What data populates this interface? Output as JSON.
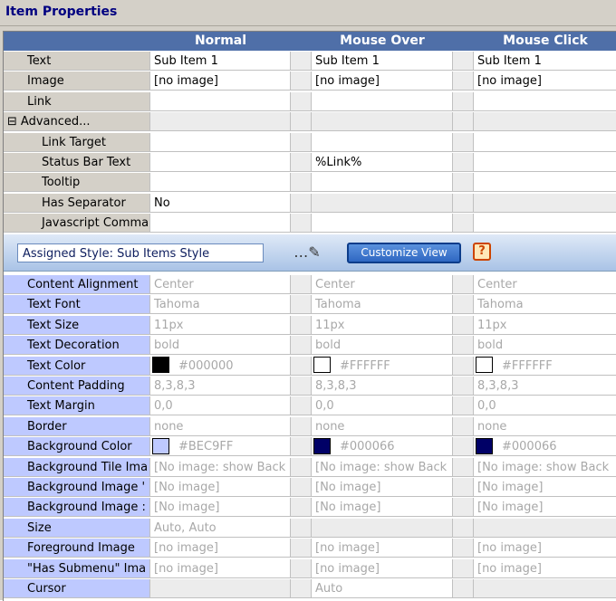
{
  "window": {
    "title": "Item Properties"
  },
  "columns": {
    "normal": "Normal",
    "mouse_over": "Mouse Over",
    "mouse_click": "Mouse Click"
  },
  "item_rows": [
    {
      "label": "Text",
      "normal": "Sub Item 1",
      "mouse_over": "Sub Item 1",
      "mouse_click": "Sub Item 1"
    },
    {
      "label": "Image",
      "normal": "[no image]",
      "mouse_over": "[no image]",
      "mouse_click": "[no image]"
    },
    {
      "label": "Link",
      "normal": "",
      "mouse_over": "",
      "mouse_click": ""
    },
    {
      "label": "Advanced...",
      "normal": "",
      "mouse_over": "",
      "mouse_click": "",
      "expander": "⊟"
    },
    {
      "label": "Link Target",
      "normal": "",
      "mouse_over": "",
      "mouse_click": ""
    },
    {
      "label": "Status Bar Text",
      "normal": "",
      "mouse_over": "%Link%",
      "mouse_click": ""
    },
    {
      "label": "Tooltip",
      "normal": "",
      "mouse_over": "",
      "mouse_click": ""
    },
    {
      "label": "Has Separator",
      "normal": "No",
      "mouse_over": "",
      "mouse_click": ""
    },
    {
      "label": "Javascript Comma",
      "normal": "",
      "mouse_over": "",
      "mouse_click": ""
    }
  ],
  "style_bar": {
    "assigned_style": "Assigned Style: Sub Items Style",
    "edit_icon": "pencil-icon",
    "customize_label": "Customize View",
    "help_label": "?"
  },
  "style_rows": [
    {
      "label": "Content Alignment",
      "normal": "Center",
      "mouse_over": "Center",
      "mouse_click": "Center"
    },
    {
      "label": "Text Font",
      "normal": "Tahoma",
      "mouse_over": "Tahoma",
      "mouse_click": "Tahoma"
    },
    {
      "label": "Text Size",
      "normal": "11px",
      "mouse_over": "11px",
      "mouse_click": "11px"
    },
    {
      "label": "Text Decoration",
      "normal": "bold",
      "mouse_over": "bold",
      "mouse_click": "bold"
    },
    {
      "label": "Text Color",
      "normal": "#000000",
      "mouse_over": "#FFFFFF",
      "mouse_click": "#FFFFFF",
      "swatches": {
        "normal": "#000000",
        "mouse_over": "#FFFFFF",
        "mouse_click": "#FFFFFF"
      }
    },
    {
      "label": "Content Padding",
      "normal": "8,3,8,3",
      "mouse_over": "8,3,8,3",
      "mouse_click": "8,3,8,3"
    },
    {
      "label": "Text Margin",
      "normal": "0,0",
      "mouse_over": "0,0",
      "mouse_click": "0,0"
    },
    {
      "label": "Border",
      "normal": "none",
      "mouse_over": "none",
      "mouse_click": "none"
    },
    {
      "label": "Background Color",
      "normal": "#BEC9FF",
      "mouse_over": "#000066",
      "mouse_click": "#000066",
      "swatches": {
        "normal": "#BEC9FF",
        "mouse_over": "#000066",
        "mouse_click": "#000066"
      }
    },
    {
      "label": "Background Tile Ima",
      "normal": "[No image: show Back",
      "mouse_over": "[No image: show Back",
      "mouse_click": "[No image: show Back"
    },
    {
      "label": "Background Image '",
      "normal": "[No image]",
      "mouse_over": "[No image]",
      "mouse_click": "[No image]"
    },
    {
      "label": "Background Image :",
      "normal": "[No image]",
      "mouse_over": "[No image]",
      "mouse_click": "[No image]"
    },
    {
      "label": "Size",
      "normal": "Auto, Auto",
      "mouse_over": "",
      "mouse_click": ""
    },
    {
      "label": "Foreground Image",
      "normal": "[no image]",
      "mouse_over": "[no image]",
      "mouse_click": "[no image]"
    },
    {
      "label": "\"Has Submenu\" Ima",
      "normal": "[no image]",
      "mouse_over": "[no image]",
      "mouse_click": "[no image]"
    },
    {
      "label": "Cursor",
      "normal": "",
      "mouse_over": "Auto",
      "mouse_click": ""
    }
  ]
}
